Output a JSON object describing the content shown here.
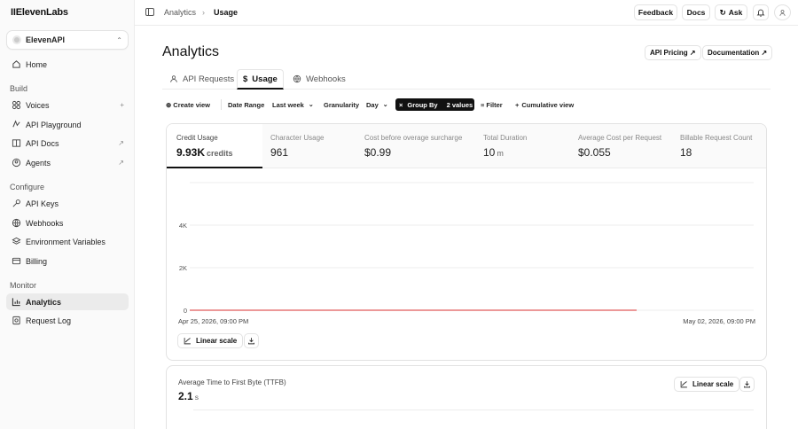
{
  "app": {
    "logo": "IIElevenLabs",
    "workspace": "ElevenAPI"
  },
  "sidebar": {
    "top": [
      {
        "label": "Home",
        "icon": "home-icon"
      }
    ],
    "build_label": "Build",
    "build": [
      {
        "label": "Voices",
        "icon": "voices-icon",
        "trailing": "+"
      },
      {
        "label": "API Playground",
        "icon": "playground-icon",
        "trailing": ""
      },
      {
        "label": "API Docs",
        "icon": "docs-icon",
        "trailing": "↗"
      },
      {
        "label": "Agents",
        "icon": "agents-icon",
        "trailing": "↗"
      }
    ],
    "configure_label": "Configure",
    "configure": [
      {
        "label": "API Keys",
        "icon": "key-icon"
      },
      {
        "label": "Webhooks",
        "icon": "webhooks-icon"
      },
      {
        "label": "Environment Variables",
        "icon": "layers-icon"
      },
      {
        "label": "Billing",
        "icon": "billing-icon"
      }
    ],
    "monitor_label": "Monitor",
    "monitor": [
      {
        "label": "Analytics",
        "icon": "chart-icon",
        "active": true
      },
      {
        "label": "Request Log",
        "icon": "log-icon"
      }
    ]
  },
  "topbar": {
    "breadcrumb": [
      "Analytics",
      "Usage"
    ],
    "feedback": "Feedback",
    "docs": "Docs",
    "ask": "Ask"
  },
  "page": {
    "title": "Analytics",
    "api_pricing": "API Pricing ↗",
    "documentation": "Documentation ↗",
    "tabs": [
      {
        "label": "API Requests",
        "icon": "api-requests-icon"
      },
      {
        "label": "Usage",
        "icon": "dollar-icon",
        "active": true
      },
      {
        "label": "Webhooks",
        "icon": "webhooks-icon"
      }
    ]
  },
  "filters": {
    "create_view": "Create view",
    "date_range_label": "Date Range",
    "date_range_value": "Last week",
    "granularity_label": "Granularity",
    "granularity_value": "Day",
    "group_by_label": "Group By",
    "group_by_value": "2 values",
    "filter": "Filter",
    "cumulative": "Cumulative view"
  },
  "kpis": [
    {
      "label": "Credit Usage",
      "value": "9.93K",
      "unit": "credits",
      "active": true
    },
    {
      "label": "Character Usage",
      "value": "961",
      "unit": ""
    },
    {
      "label": "Cost before overage surcharge",
      "value": "$0.99",
      "unit": ""
    },
    {
      "label": "Total Duration",
      "value": "10",
      "unit": "m"
    },
    {
      "label": "Average Cost per Request",
      "value": "$0.055",
      "unit": ""
    },
    {
      "label": "Billable Request Count",
      "value": "18",
      "unit": ""
    }
  ],
  "chart_data": {
    "type": "line",
    "x_start": "Apr 25, 2026, 09:00 PM",
    "x_end": "May 02, 2026, 09:00 PM",
    "y_ticks": [
      "0",
      "2K",
      "4K"
    ],
    "y_tick_values": [
      0,
      2000,
      4000
    ],
    "ylim": [
      0,
      6000
    ],
    "series": [
      {
        "values": [
          0,
          0,
          0,
          0,
          0,
          0,
          0,
          0
        ],
        "color": "#e05a5a"
      }
    ]
  },
  "chart_controls": {
    "scale": "Linear scale"
  },
  "card2": {
    "label": "Average Time to First Byte (TTFB)",
    "value": "2.1",
    "unit": "s",
    "scale": "Linear scale"
  },
  "colors": {
    "accent": "#111111",
    "line": "#e05a5a",
    "grid": "#ececec"
  }
}
